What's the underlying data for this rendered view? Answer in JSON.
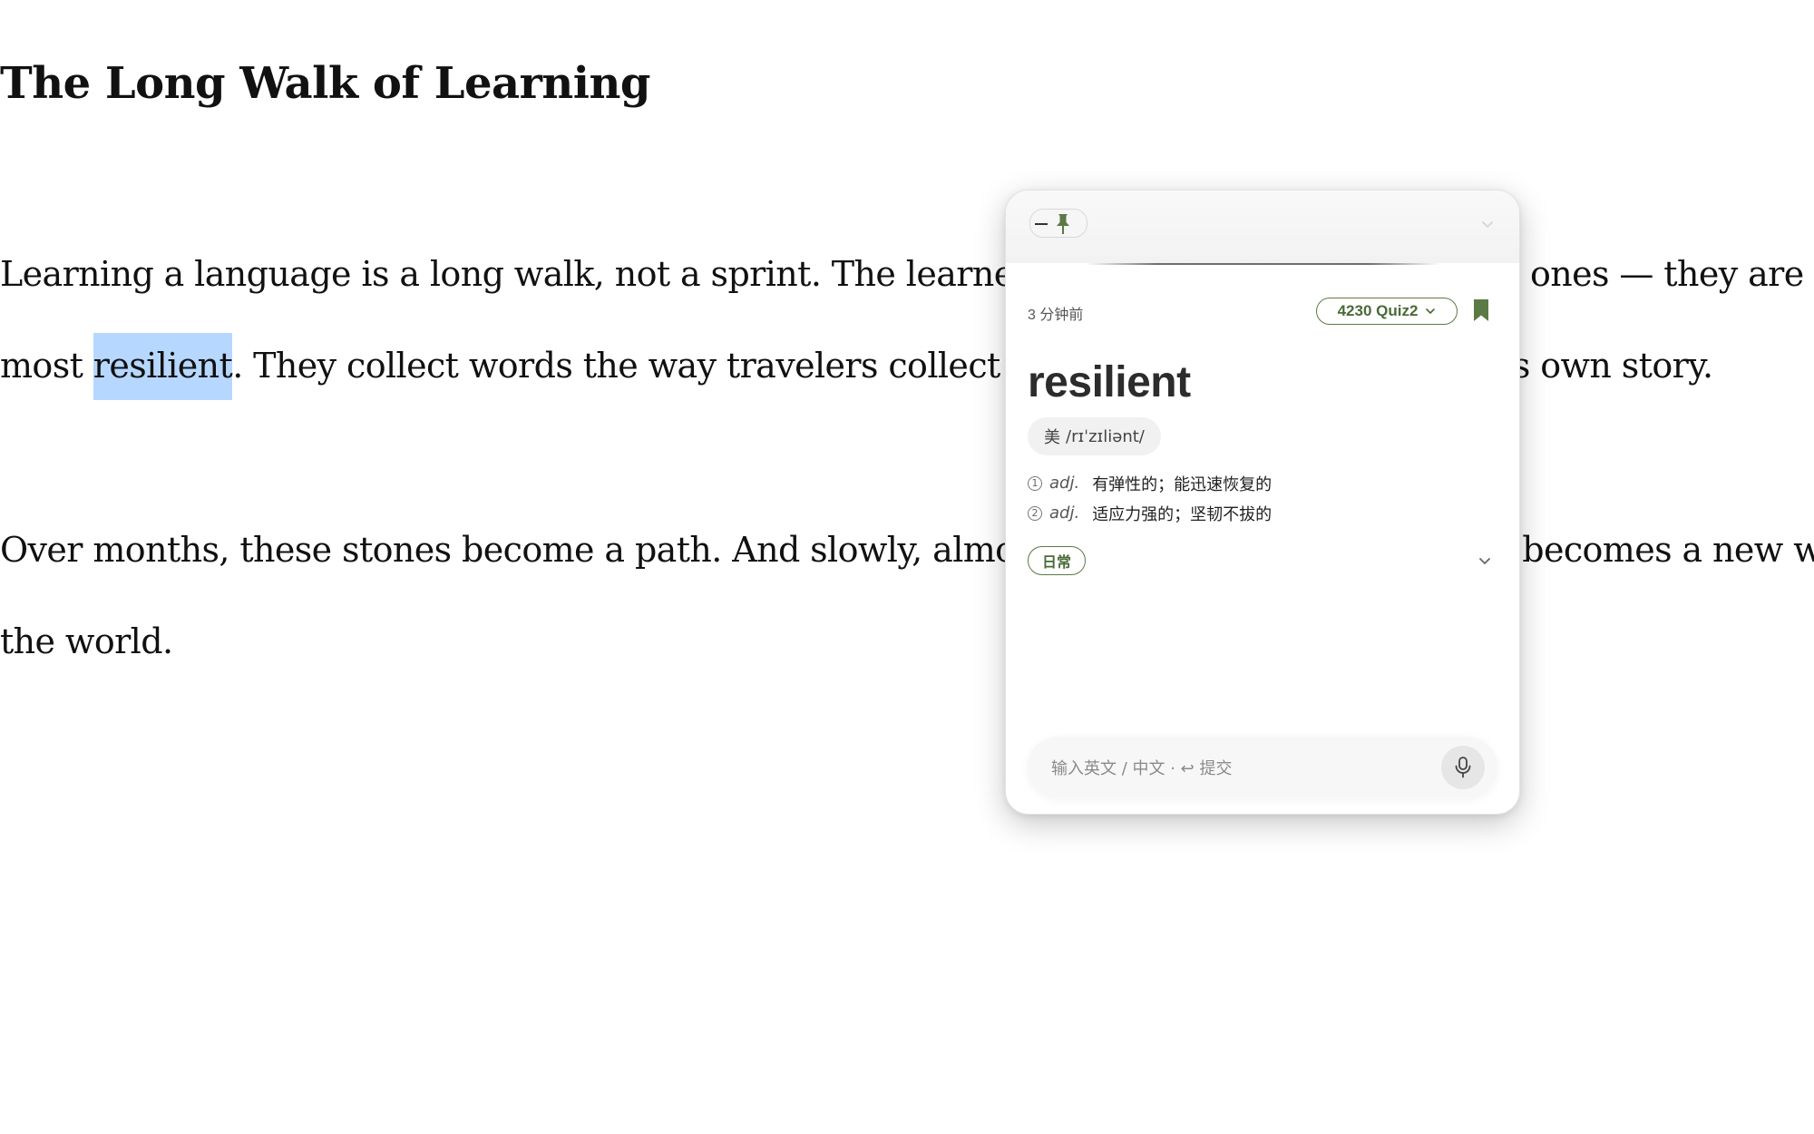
{
  "article": {
    "title": "The Long Walk of Learning",
    "paragraph1": {
      "line1": "Learning a language is a long walk, not a sprint. The learners who last are not the fastest ones — they are the",
      "line2_before": "most ",
      "line2_highlight": "resilient",
      "line2_after": ". They collect words the way travelers collect small stones, each one with its own story."
    },
    "paragraph2": {
      "line1": "Over months, these stones become a path. And slowly, almost without noticing, language becomes a new way of seeing",
      "line2": "the world."
    }
  },
  "popup": {
    "timestamp": "3 分钟前",
    "wordlist": "4230 Quiz2",
    "word": "resilient",
    "phonetic_region": "美",
    "phonetic": "/rɪˈzɪliənt/",
    "definitions": [
      {
        "num": "1",
        "pos": "adj.",
        "text": "有弹性的；能迅速恢复的"
      },
      {
        "num": "2",
        "pos": "adj.",
        "text": "适应力强的；坚韧不拔的"
      }
    ],
    "tag": "日常",
    "input_placeholder": "输入英文 / 中文 · ↩ 提交",
    "accent_color": "#5b7a45"
  }
}
